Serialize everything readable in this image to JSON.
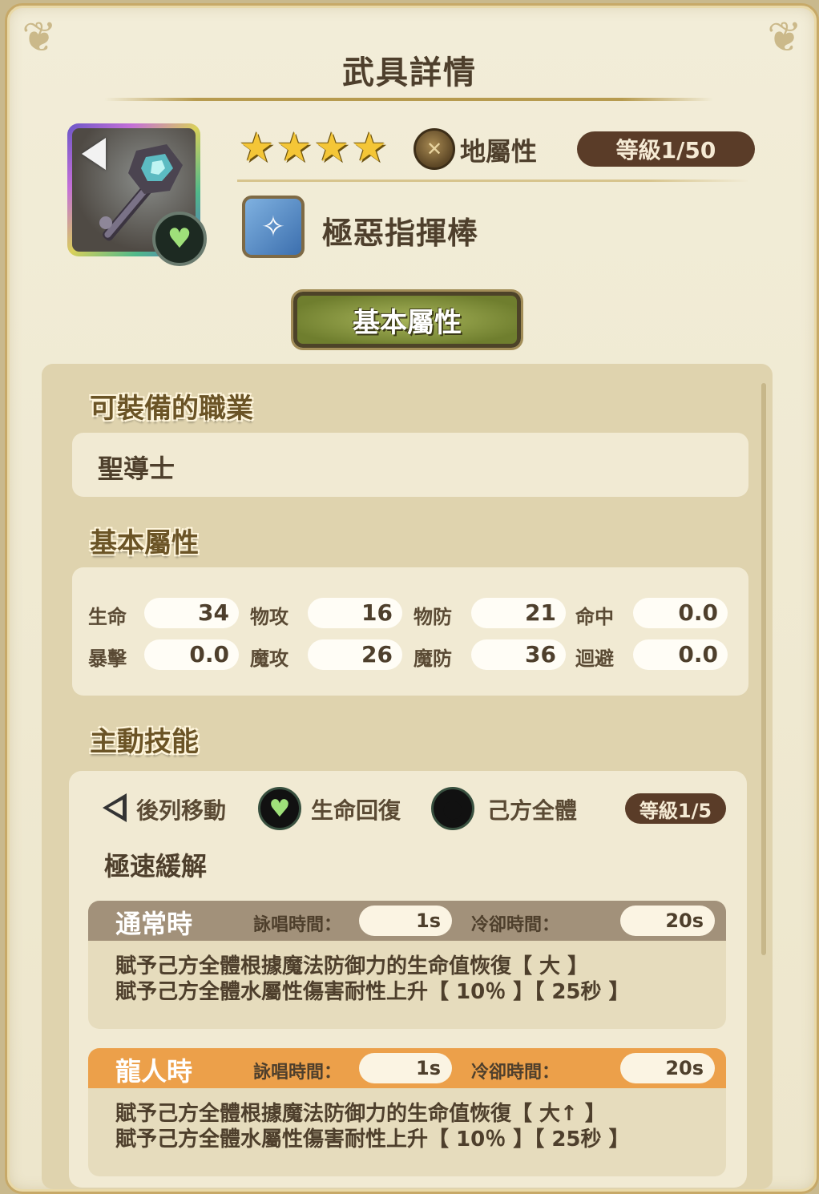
{
  "header": {
    "title": "武具詳情"
  },
  "weapon": {
    "stars": [
      "★",
      "★",
      "★",
      "★"
    ],
    "element": "地屬性",
    "level": "等級1/50",
    "name": "極惡指揮棒",
    "tab": "基本屬性"
  },
  "jobs": {
    "section_title": "可裝備的職業",
    "value": "聖導士"
  },
  "stats": {
    "section_title": "基本屬性",
    "items": [
      {
        "label": "生命",
        "value": "34"
      },
      {
        "label": "物攻",
        "value": "16"
      },
      {
        "label": "物防",
        "value": "21"
      },
      {
        "label": "命中",
        "value": "0.0"
      },
      {
        "label": "暴擊",
        "value": "0.0"
      },
      {
        "label": "魔攻",
        "value": "26"
      },
      {
        "label": "魔防",
        "value": "36"
      },
      {
        "label": "迴避",
        "value": "0.0"
      }
    ]
  },
  "skill": {
    "section_title": "主動技能",
    "move": "後列移動",
    "effect": "生命回復",
    "target": "己方全體",
    "level": "等級1/5",
    "name": "極速緩解",
    "cards": [
      {
        "state": "通常時",
        "cast_label": "詠唱時間：",
        "cast_value": "1s",
        "cd_label": "冷卻時間：",
        "cd_value": "20s",
        "desc_1": "賦予己方全體根據魔法防御力的生命值恢復【 大 】",
        "desc_2": "賦予己方全體水屬性傷害耐性上升【 10％ 】【 25秒 】"
      },
      {
        "state": "龍人時",
        "cast_label": "詠唱時間：",
        "cast_value": "1s",
        "cd_label": "冷卻時間：",
        "cd_value": "20s",
        "desc_1": "賦予己方全體根據魔法防御力的生命值恢復【 大↑ 】",
        "desc_2": "賦予己方全體水屬性傷害耐性上升【 10％ 】【 25秒 】"
      }
    ]
  },
  "icons": {
    "corner": "ornament-icon",
    "back": "back-triangle-icon",
    "heart": "heart-icon",
    "earth": "earth-element-icon",
    "wand": "wand-type-icon",
    "all": "all-allies-icon"
  },
  "colors": {
    "level_pill": "#5a3c28",
    "tab_green": "#8a9a3e",
    "normal_header": "#a2917a",
    "dragon_header": "#eca04a"
  }
}
